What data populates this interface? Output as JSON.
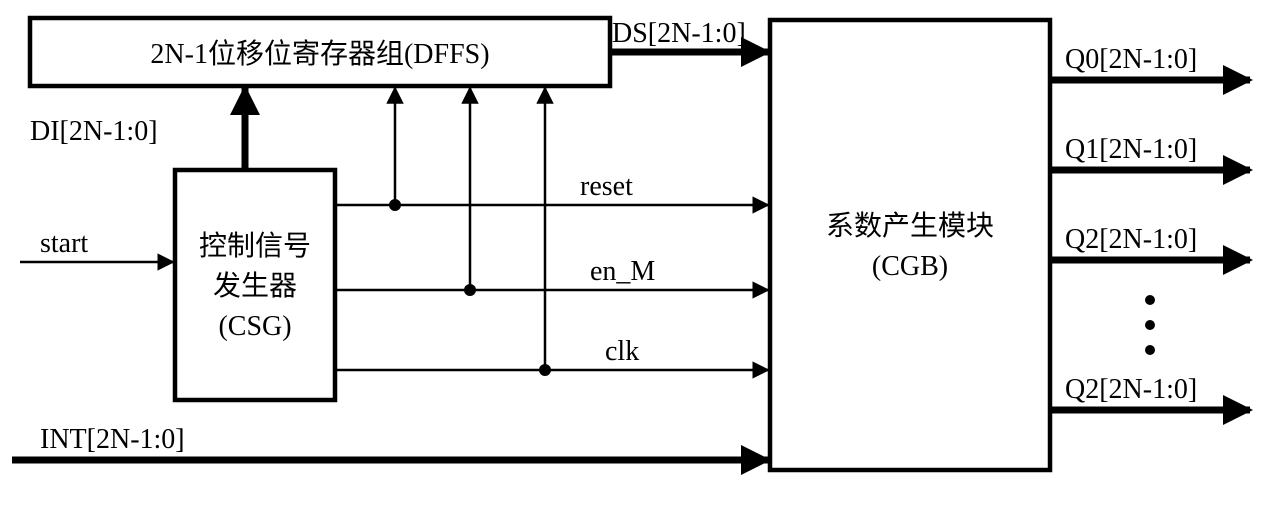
{
  "blocks": {
    "dffs": {
      "line1": "2N-1位移位寄存器组(DFFS)"
    },
    "csg": {
      "line1": "控制信号",
      "line2": "发生器",
      "line3": "(CSG)"
    },
    "cgb": {
      "line1": "系数产生模块",
      "line2": "(CGB)"
    }
  },
  "signals": {
    "DI": "DI[2N-1:0]",
    "DS": "DS[2N-1:0]",
    "start": "start",
    "reset": "reset",
    "en_M": "en_M",
    "clk": "clk",
    "INT": "INT[2N-1:0]"
  },
  "outputs": {
    "q0": "Q0[2N-1:0]",
    "q1": "Q1[2N-1:0]",
    "q2a": "Q2[2N-1:0]",
    "q2b": "Q2[2N-1:0]"
  },
  "chart_data": {
    "type": "diagram",
    "title": "Block diagram: DFFS / CSG / CGB",
    "blocks": [
      {
        "id": "DFFS",
        "label": "2N-1位移位寄存器组(DFFS)",
        "inputs": [
          "DI[2N-1:0]",
          "reset",
          "en_M",
          "clk"
        ],
        "outputs": [
          "DS[2N-1:0]"
        ]
      },
      {
        "id": "CSG",
        "label": "控制信号发生器 (CSG)",
        "inputs": [
          "start"
        ],
        "outputs": [
          "DI[2N-1:0]",
          "reset",
          "en_M",
          "clk"
        ]
      },
      {
        "id": "CGB",
        "label": "系数产生模块 (CGB)",
        "inputs": [
          "DS[2N-1:0]",
          "reset",
          "en_M",
          "clk",
          "INT[2N-1:0]"
        ],
        "outputs": [
          "Q0[2N-1:0]",
          "Q1[2N-1:0]",
          "Q2[2N-1:0]",
          "…",
          "Q2[2N-1:0]"
        ]
      }
    ],
    "external_inputs": [
      "start",
      "INT[2N-1:0]"
    ],
    "external_outputs": [
      "Q0[2N-1:0]",
      "Q1[2N-1:0]",
      "Q2[2N-1:0]",
      "…",
      "Q2[2N-1:0]"
    ],
    "nets": [
      {
        "name": "DI[2N-1:0]",
        "from": "CSG",
        "to": [
          "DFFS"
        ],
        "style": "bus"
      },
      {
        "name": "DS[2N-1:0]",
        "from": "DFFS",
        "to": [
          "CGB"
        ],
        "style": "bus"
      },
      {
        "name": "reset",
        "from": "CSG",
        "to": [
          "DFFS",
          "CGB"
        ],
        "style": "wire"
      },
      {
        "name": "en_M",
        "from": "CSG",
        "to": [
          "DFFS",
          "CGB"
        ],
        "style": "wire"
      },
      {
        "name": "clk",
        "from": "CSG",
        "to": [
          "DFFS",
          "CGB"
        ],
        "style": "wire"
      },
      {
        "name": "INT[2N-1:0]",
        "from": "external",
        "to": [
          "CGB"
        ],
        "style": "bus"
      },
      {
        "name": "start",
        "from": "external",
        "to": [
          "CSG"
        ],
        "style": "wire"
      }
    ]
  }
}
